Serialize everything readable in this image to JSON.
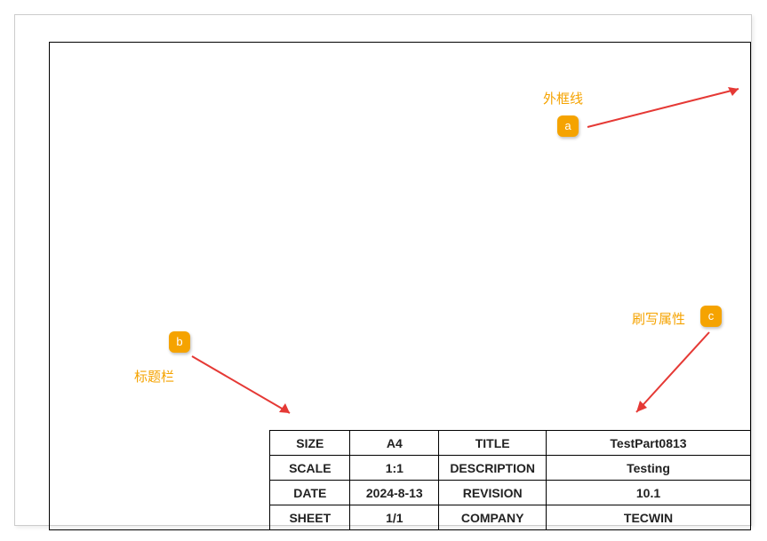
{
  "annotations": {
    "a": {
      "marker": "a",
      "label": "外框线"
    },
    "b": {
      "marker": "b",
      "label": "标题栏"
    },
    "c": {
      "marker": "c",
      "label": "刷写属性"
    }
  },
  "title_block": {
    "rows": [
      {
        "label1": "SIZE",
        "val1": "A4",
        "label2": "TITLE",
        "val2": "TestPart0813"
      },
      {
        "label1": "SCALE",
        "val1": "1:1",
        "label2": "DESCRIPTION",
        "val2": "Testing"
      },
      {
        "label1": "DATE",
        "val1": "2024-8-13",
        "label2": "REVISION",
        "val2": "10.1"
      },
      {
        "label1": "SHEET",
        "val1": "1/1",
        "label2": "COMPANY",
        "val2": "TECWIN"
      }
    ]
  }
}
